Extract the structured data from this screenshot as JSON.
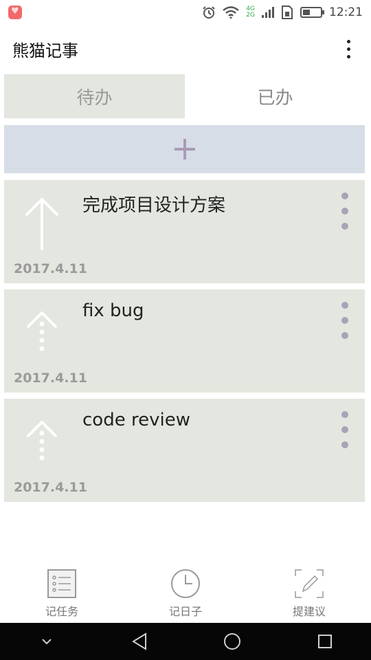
{
  "status_bar": {
    "network_top": "4G",
    "network_bottom": "2G",
    "time": "12:21",
    "battery_level": 0.4
  },
  "app_bar": {
    "title": "熊猫记事"
  },
  "tabs": [
    {
      "label": "待办",
      "active": true
    },
    {
      "label": "已办",
      "active": false
    }
  ],
  "tasks": [
    {
      "title": "完成项目设计方案",
      "date": "2017.4.11",
      "priority_icon": "arrow-up-solid-icon"
    },
    {
      "title": "fix bug",
      "date": "2017.4.11",
      "priority_icon": "arrow-up-dotted-icon"
    },
    {
      "title": "code review",
      "date": "2017.4.11",
      "priority_icon": "arrow-up-dotted-icon"
    }
  ],
  "bottom_nav": [
    {
      "label": "记任务",
      "icon": "checklist-icon"
    },
    {
      "label": "记日子",
      "icon": "clock-icon"
    },
    {
      "label": "提建议",
      "icon": "edit-pen-icon"
    }
  ],
  "colors": {
    "card_bg": "#e3e7df",
    "add_bar_bg": "#d6dde7",
    "plus_color": "#a99bb5",
    "menu_dots": "#a8a3b8"
  }
}
